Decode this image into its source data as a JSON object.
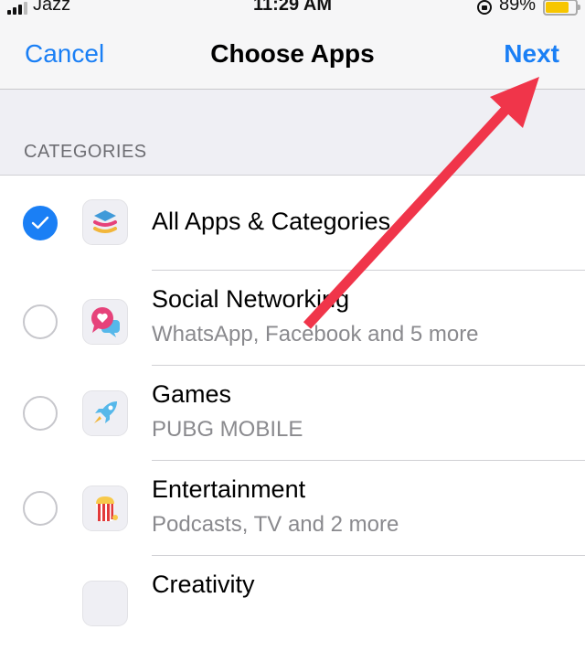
{
  "status_bar": {
    "carrier": "Jazz",
    "time": "11:29 AM",
    "battery_percent": "89%",
    "battery_level": 0.89,
    "battery_color": "#f7c600"
  },
  "navbar": {
    "cancel_label": "Cancel",
    "title": "Choose Apps",
    "next_label": "Next",
    "accent_color": "#1a7ff5"
  },
  "section_header": "CATEGORIES",
  "categories": [
    {
      "label": "All Apps & Categories",
      "subtitle": "",
      "selected": true,
      "icon": "layers-icon"
    },
    {
      "label": "Social Networking",
      "subtitle": "WhatsApp, Facebook and 5 more",
      "selected": false,
      "icon": "chat-heart-icon"
    },
    {
      "label": "Games",
      "subtitle": "PUBG MOBILE",
      "selected": false,
      "icon": "rocket-icon"
    },
    {
      "label": "Entertainment",
      "subtitle": "Podcasts, TV and 2 more",
      "selected": false,
      "icon": "popcorn-icon"
    },
    {
      "label": "Creativity",
      "subtitle": "",
      "selected": false,
      "icon": "creativity-icon"
    }
  ],
  "annotation": {
    "type": "arrow",
    "color": "#f0354a",
    "points_to": "next-button"
  }
}
